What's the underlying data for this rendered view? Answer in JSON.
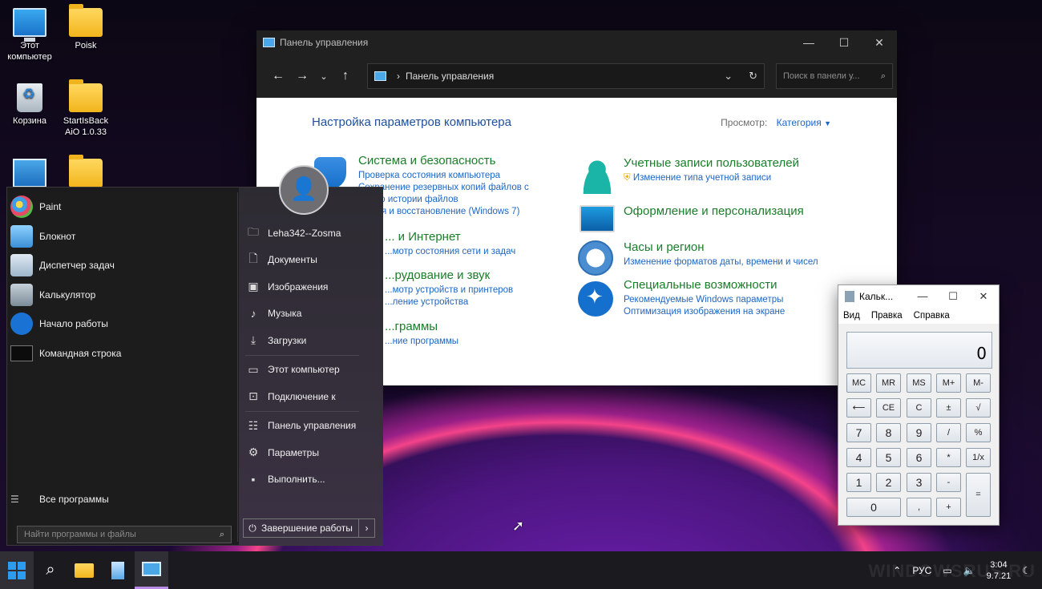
{
  "desktop": {
    "icons": [
      {
        "label": "Этот компьютер"
      },
      {
        "label": "Poisk"
      },
      {
        "label": "Корзина"
      },
      {
        "label": "StartIsBack AiO 1.0.33"
      },
      {
        "label": ""
      },
      {
        "label": ""
      }
    ]
  },
  "control_panel": {
    "title": "Панель управления",
    "address": "Панель управления",
    "search_placeholder": "Поиск в панели у...",
    "heading": "Настройка параметров компьютера",
    "view_label": "Просмотр:",
    "view_value": "Категория",
    "categories_left": [
      {
        "title": "Система и безопасность",
        "links": [
          "Проверка состояния компьютера",
          "Сохранение резервных копий файлов с",
          "...щью истории файлов",
          "...ация и восстановление (Windows 7)"
        ]
      },
      {
        "title": "... и Интернет",
        "links": [
          "...мотр состояния сети и задач"
        ]
      },
      {
        "title": "...рудование и звук",
        "links": [
          "...мотр устройств и принтеров",
          "...ление устройства"
        ]
      },
      {
        "title": "...граммы",
        "links": [
          "...ние программы"
        ]
      }
    ],
    "categories_right": [
      {
        "title": "Учетные записи пользователей",
        "links": [
          "Изменение типа учетной записи"
        ]
      },
      {
        "title": "Оформление и персонализация",
        "links": []
      },
      {
        "title": "Часы и регион",
        "links": [
          "Изменение форматов даты, времени и чисел"
        ]
      },
      {
        "title": "Специальные возможности",
        "links": [
          "Рекомендуемые Windows параметры",
          "Оптимизация изображения на экране"
        ]
      }
    ]
  },
  "start_menu": {
    "programs": [
      "Paint",
      "Блокнот",
      "Диспетчер задач",
      "Калькулятор",
      "Начало работы",
      "Командная строка"
    ],
    "all_programs": "Все программы",
    "search_placeholder": "Найти программы и файлы",
    "right_items": [
      "Leha342--Zosma",
      "Документы",
      "Изображения",
      "Музыка",
      "Загрузки",
      "Этот компьютер",
      "Подключение к",
      "Панель управления",
      "Параметры",
      "Выполнить..."
    ],
    "shutdown": "Завершение работы"
  },
  "calculator": {
    "title": "Кальк...",
    "menu": [
      "Вид",
      "Правка",
      "Справка"
    ],
    "display": "0",
    "buttons": [
      "MC",
      "MR",
      "MS",
      "M+",
      "M-",
      "⟵",
      "CE",
      "C",
      "±",
      "√",
      "7",
      "8",
      "9",
      "/",
      "%",
      "4",
      "5",
      "6",
      "*",
      "1/x",
      "1",
      "2",
      "3",
      "-",
      "=",
      "0",
      ",",
      "+"
    ]
  },
  "taskbar": {
    "lang": "РУС",
    "time": "3:04",
    "date": "9.7.21",
    "watermark": "WINDOWSRUS.RU"
  }
}
